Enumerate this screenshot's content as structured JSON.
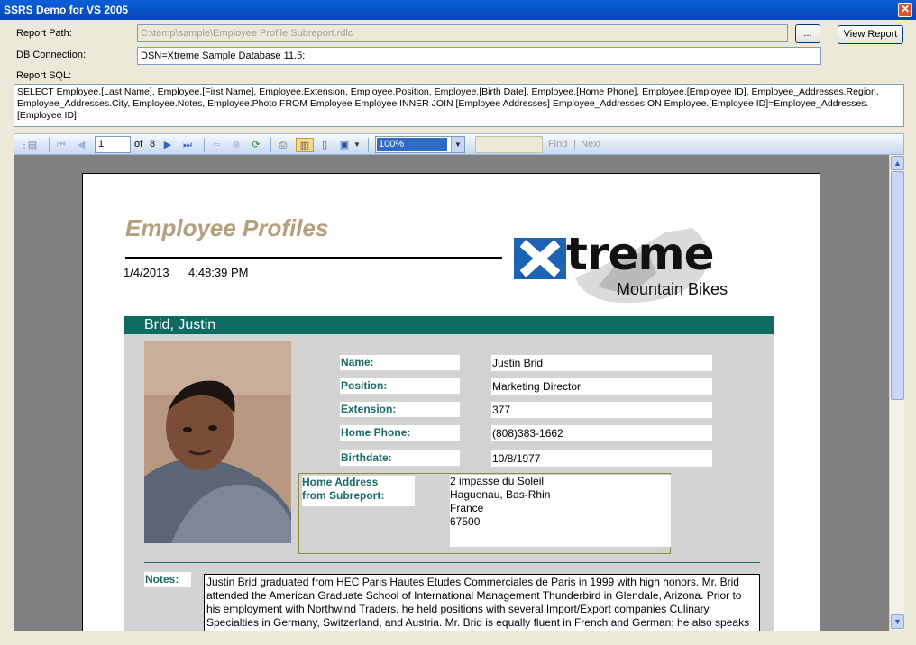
{
  "window": {
    "title": "SSRS Demo for VS 2005"
  },
  "form": {
    "report_path_label": "Report Path:",
    "report_path_value": "C:\\temp\\sample\\Employee Profile Subreport.rdlc",
    "browse_label": "...",
    "view_report_label": "View Report",
    "db_connection_label": "DB Connection:",
    "db_connection_value": "DSN=Xtreme Sample Database 11.5;",
    "report_sql_label": "Report SQL:",
    "report_sql_value": "SELECT Employee.[Last Name], Employee.[First Name], Employee.Extension, Employee.Position, Employee.[Birth Date], Employee.[Home Phone], Employee.[Employee ID], Employee_Addresses.Region, Employee_Addresses.City, Employee.Notes, Employee.Photo FROM   Employee Employee INNER JOIN [Employee Addresses] Employee_Addresses ON Employee.[Employee ID]=Employee_Addresses.[Employee ID]"
  },
  "toolbar": {
    "page_current": "1",
    "page_of": "of",
    "page_total": "8",
    "zoom": "100%",
    "find_label": "Find",
    "next_label": "Next",
    "separator": "|"
  },
  "report": {
    "title": "Employee Profiles",
    "date": "1/4/2013",
    "time": "4:48:39 PM",
    "logo_main": "treme",
    "logo_sub": "Mountain Bikes",
    "employee_header": "Brid, Justin",
    "fields": [
      {
        "label": "Name:",
        "value": "Justin Brid"
      },
      {
        "label": "Position:",
        "value": "Marketing Director"
      },
      {
        "label": "Extension:",
        "value": "377"
      },
      {
        "label": "Home Phone:",
        "value": "(808)383-1662"
      },
      {
        "label": "Birthdate:",
        "value": "10/8/1977"
      }
    ],
    "address_label_1": "Home Address",
    "address_label_2": "from Subreport:",
    "address_lines": [
      "2 impasse du Soleil",
      "Haguenau, Bas-Rhin",
      "France",
      "67500"
    ],
    "notes_label": "Notes:",
    "notes_text": "Justin Brid graduated from HEC Paris Hautes Etudes Commerciales de Paris in 1999 with high honors. Mr. Brid attended the American Graduate School of International Management Thunderbird in Glendale, Arizona.  Prior to his employment with Northwind Traders, he held positions with several  Import/Export companies Culinary Specialties in Germany, Switzerland, and Austria. Mr. Brid is equally fluent in French and German; he also speaks English and reads Spanish."
  }
}
